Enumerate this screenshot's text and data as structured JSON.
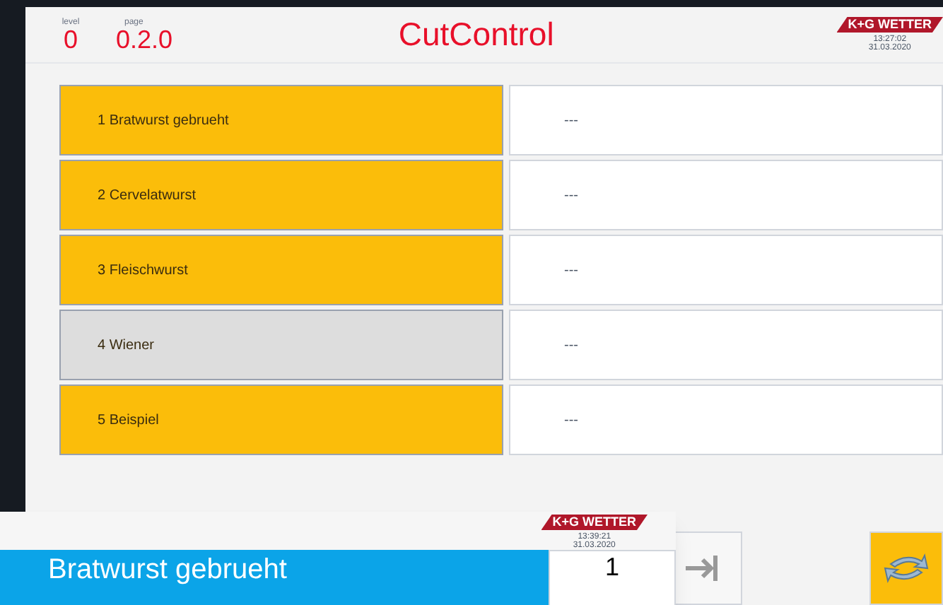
{
  "header": {
    "level_label": "level",
    "level": "0",
    "page_label": "page",
    "page": "0.2.0",
    "title": "CutControl",
    "logo": "K+G WETTER",
    "time": "13:27:02",
    "date": "31.03.2020"
  },
  "rows": [
    {
      "label": "1  Bratwurst gebrueht",
      "enabled": true,
      "value": "---"
    },
    {
      "label": "2  Cervelatwurst",
      "enabled": true,
      "value": "---"
    },
    {
      "label": "3  Fleischwurst",
      "enabled": true,
      "value": "---"
    },
    {
      "label": "4  Wiener",
      "enabled": false,
      "value": "---"
    },
    {
      "label": "5  Beispiel",
      "enabled": true,
      "value": "---"
    }
  ],
  "overlay": {
    "logo": "K+G WETTER",
    "time": "13:39:21",
    "date": "31.03.2020",
    "product": "Bratwurst gebrueht",
    "count": "1"
  }
}
